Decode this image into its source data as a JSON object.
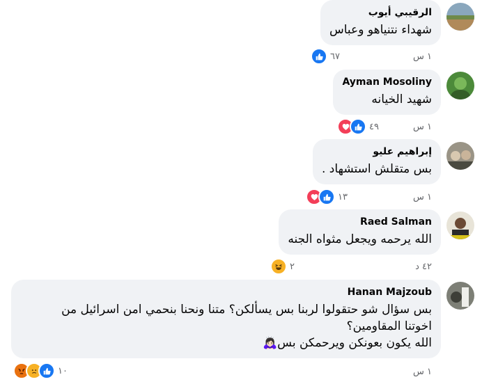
{
  "comments": [
    {
      "name": "الرقيبي أيوب",
      "text": "شهداء نتنياهو وعباس",
      "time": "١ س",
      "reaction_count": "٦٧",
      "reactions": [
        "like"
      ]
    },
    {
      "name": "Ayman Mosoliny",
      "text": "شهيد الخيانه",
      "time": "١ س",
      "reaction_count": "٤٩",
      "reactions": [
        "like",
        "love"
      ]
    },
    {
      "name": "إبراهيم عليو",
      "text": "بس متقلش استشهاد .",
      "time": "١ س",
      "reaction_count": "١٣",
      "reactions": [
        "like",
        "love"
      ]
    },
    {
      "name": "Raed Salman",
      "text": "الله يرحمه ويجعل مثواه الجنه",
      "time": "٤٢ د",
      "reaction_count": "٢",
      "reactions": [
        "haha"
      ]
    },
    {
      "name": "Hanan Majzoub",
      "text_lines": [
        "بس سؤال شو حتقولوا لربنا بس يسألكن؟ متنا ونحنا بنحمي امن اسرائيل من",
        "اخوتنا المقاومين؟",
        "الله يكون بعونكن ويرحمكن بس🙇🏻‍♀️"
      ],
      "time": "١ س",
      "reaction_count": "١٠",
      "reactions": [
        "like",
        "sad",
        "angry"
      ]
    }
  ],
  "colors": {
    "bubble": "#f0f2f5",
    "like": "#1877f2",
    "love": "#f33e58",
    "meta": "#65676b"
  }
}
